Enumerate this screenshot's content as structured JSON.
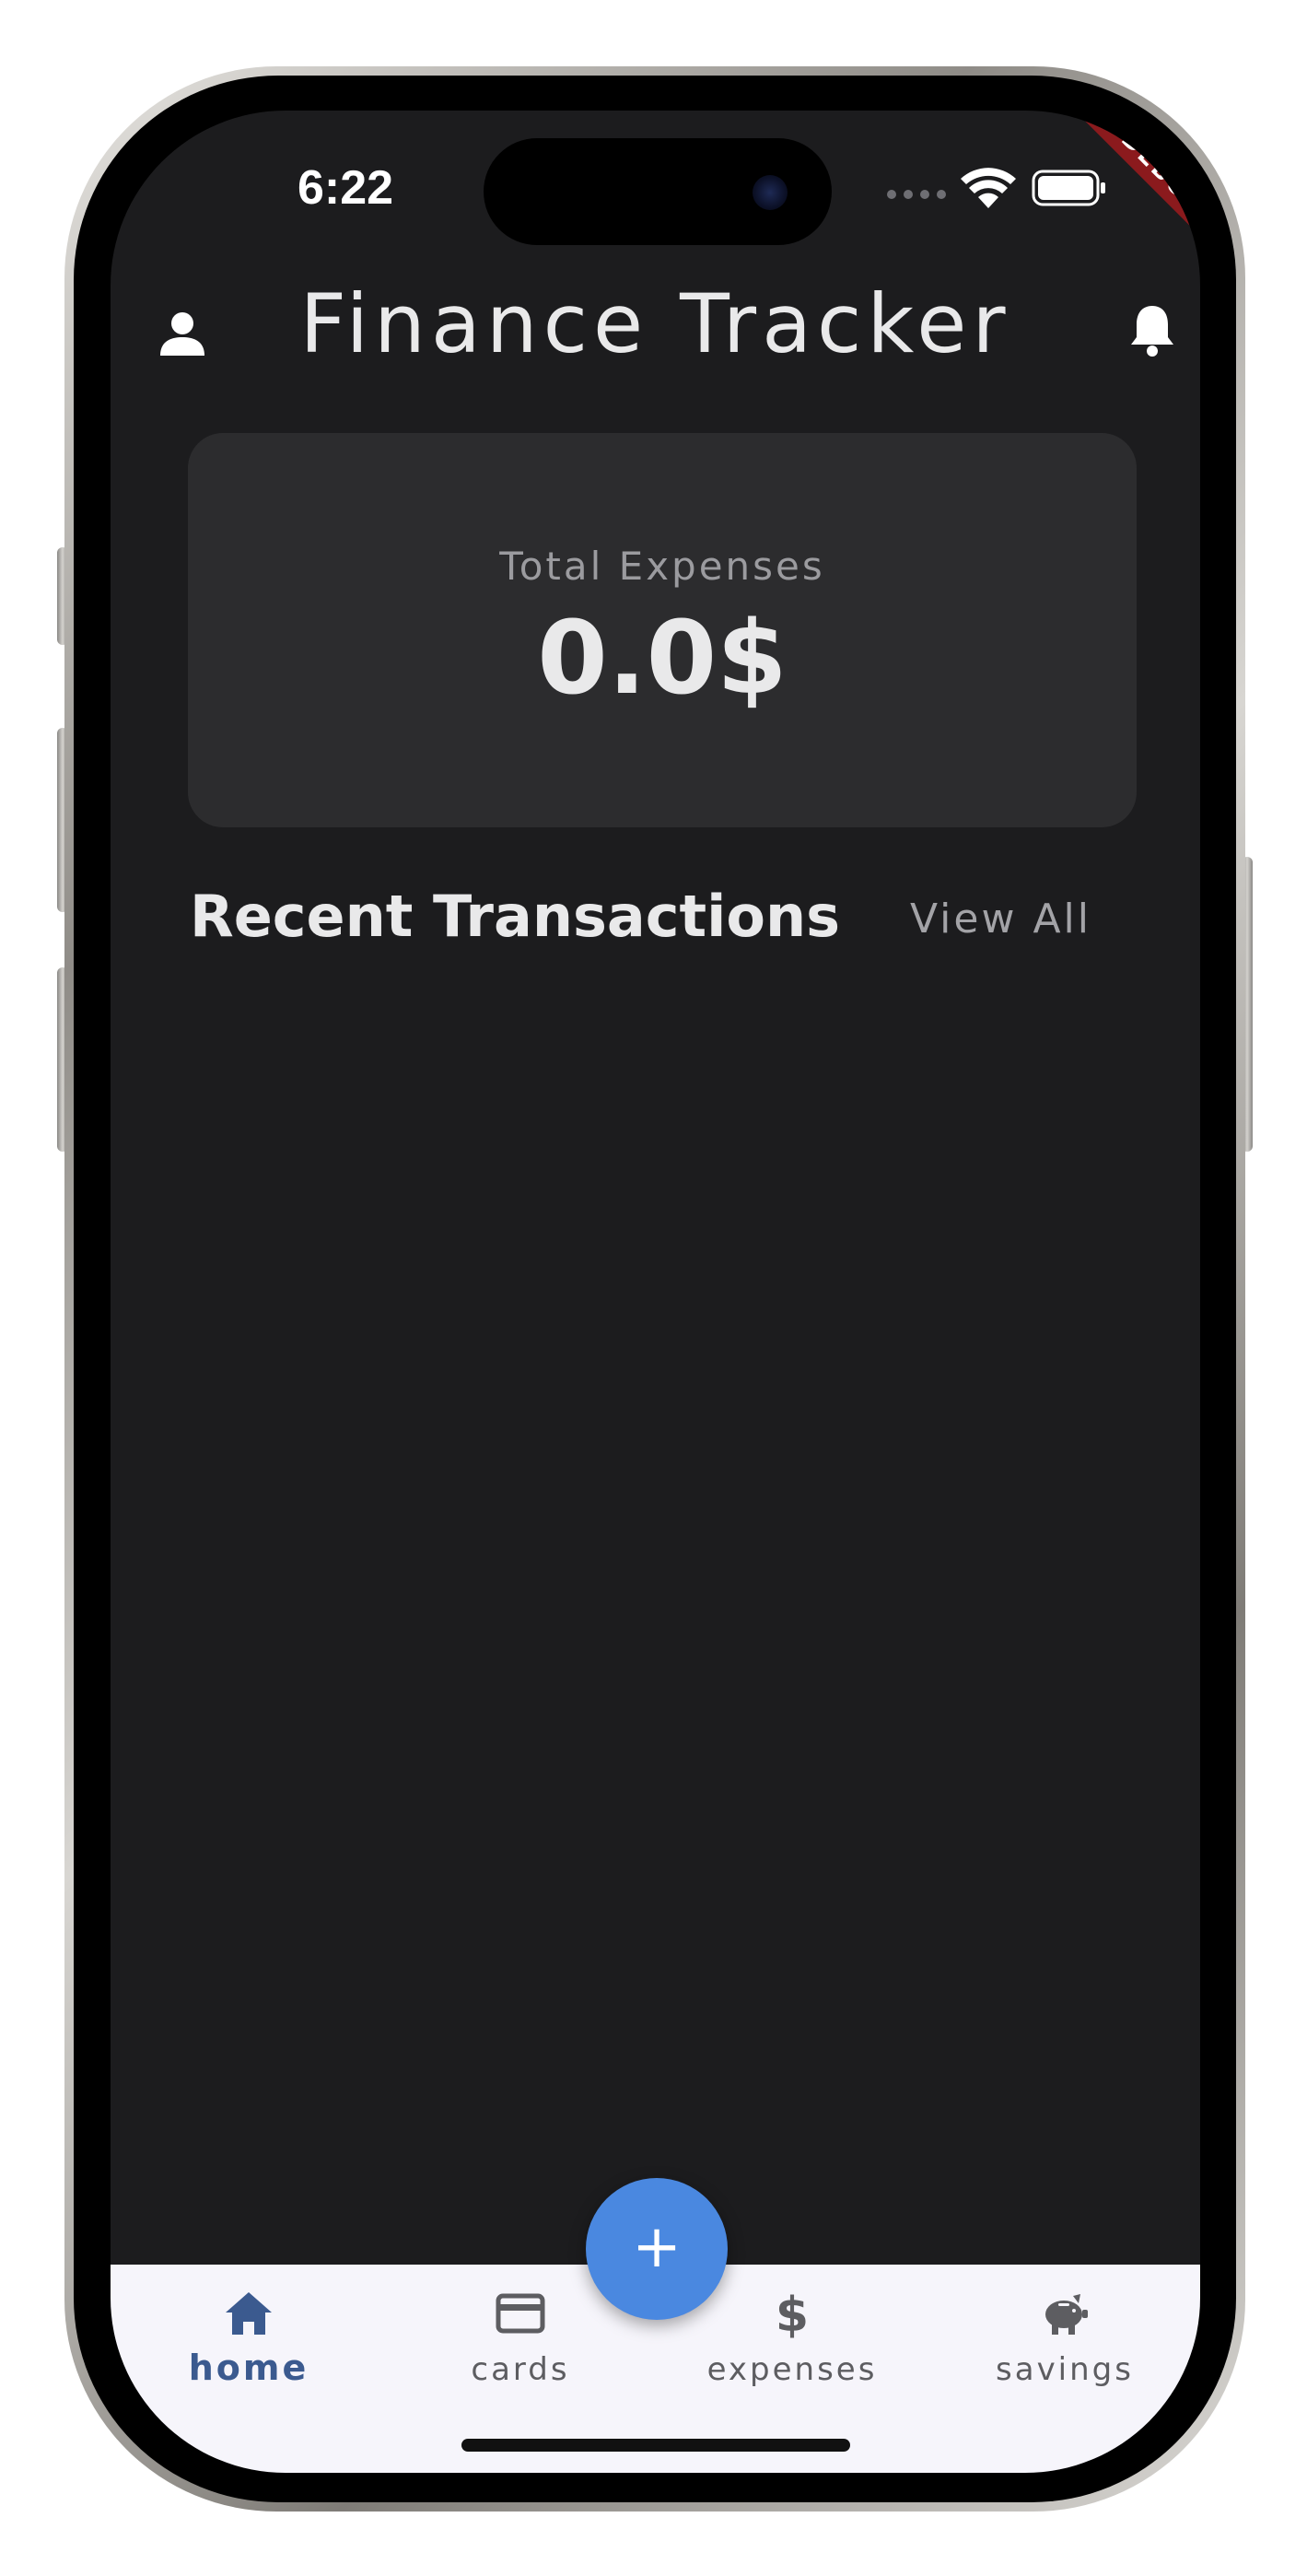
{
  "status_bar": {
    "time": "6:22",
    "debug_banner": "DEBUG"
  },
  "app_bar": {
    "title": "Finance Tracker",
    "left_icon": "person-icon",
    "right_icon": "bell-icon"
  },
  "summary": {
    "label": "Total Expenses",
    "value": "0.0$"
  },
  "transactions": {
    "title": "Recent Transactions",
    "view_all": "View All",
    "items": []
  },
  "fab": {
    "label": "+"
  },
  "bottom_nav": {
    "items": [
      {
        "label": "home",
        "icon": "home-icon",
        "active": true
      },
      {
        "label": "cards",
        "icon": "credit-card-icon",
        "active": false
      },
      {
        "label": "expenses",
        "icon": "dollar-icon",
        "active": false
      },
      {
        "label": "savings",
        "icon": "piggy-bank-icon",
        "active": false
      }
    ]
  },
  "colors": {
    "background": "#1c1c1e",
    "card": "#2c2c2e",
    "accent": "#4a88e0",
    "nav_active": "#3b5a8f",
    "nav_background": "#f6f5fb",
    "debug": "#8b1a1d"
  }
}
